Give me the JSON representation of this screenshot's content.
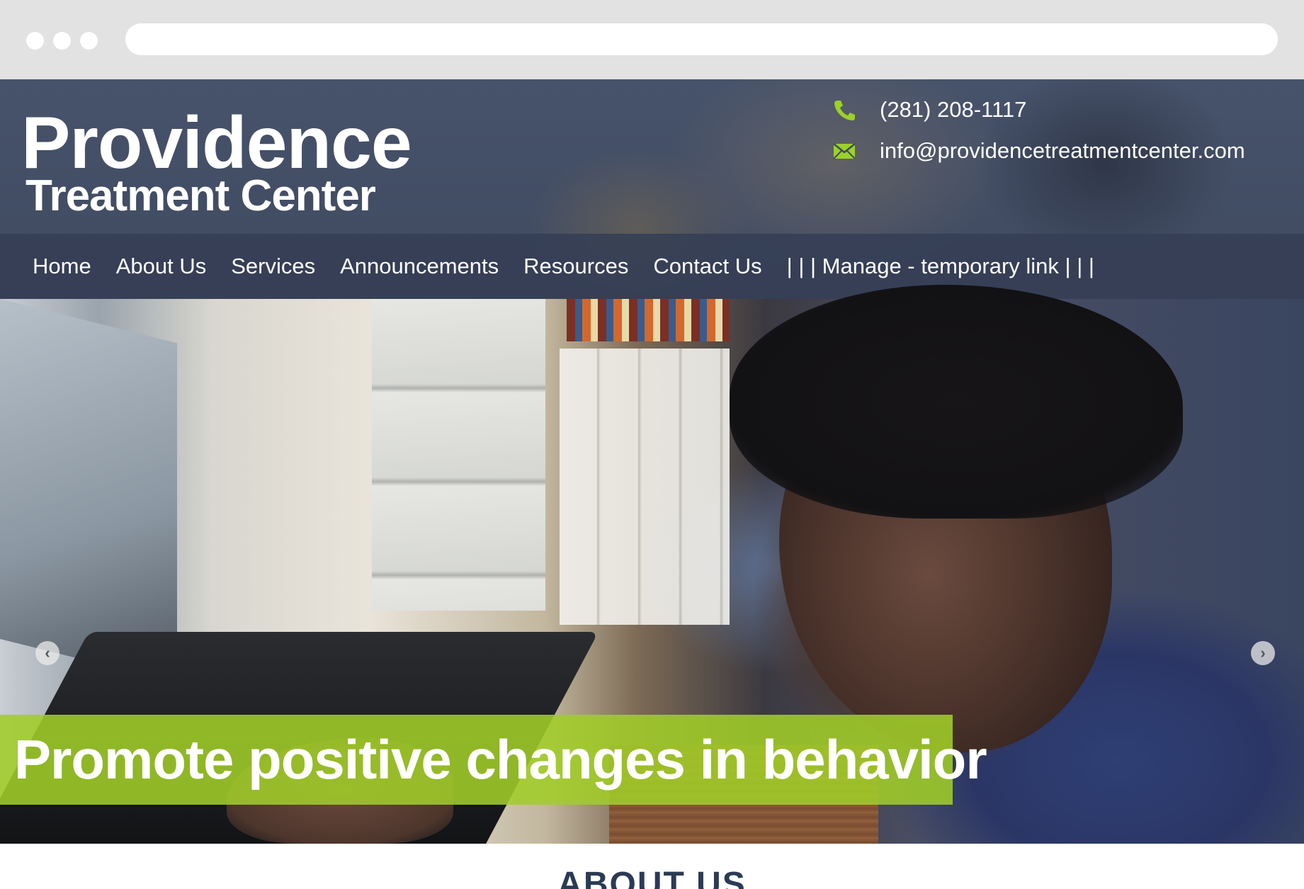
{
  "header": {
    "logo_line1": "Providence",
    "logo_line2": "Treatment Center",
    "phone": "(281) 208-1117",
    "email": "info@providencetreatmentcenter.com",
    "icons": {
      "phone": "phone-icon",
      "email": "envelope-icon"
    },
    "accent_color": "#9bd128"
  },
  "nav": {
    "items": [
      {
        "label": "Home"
      },
      {
        "label": "About Us"
      },
      {
        "label": "Services"
      },
      {
        "label": "Announcements"
      },
      {
        "label": "Resources"
      },
      {
        "label": "Contact Us"
      },
      {
        "label": "| | | Manage - temporary link | | |"
      }
    ]
  },
  "hero": {
    "caption": "Promote positive changes in behavior",
    "prev_arrow": "‹",
    "next_arrow": "›",
    "caption_color": "#a0cd28"
  },
  "about": {
    "title": "ABOUT US"
  }
}
